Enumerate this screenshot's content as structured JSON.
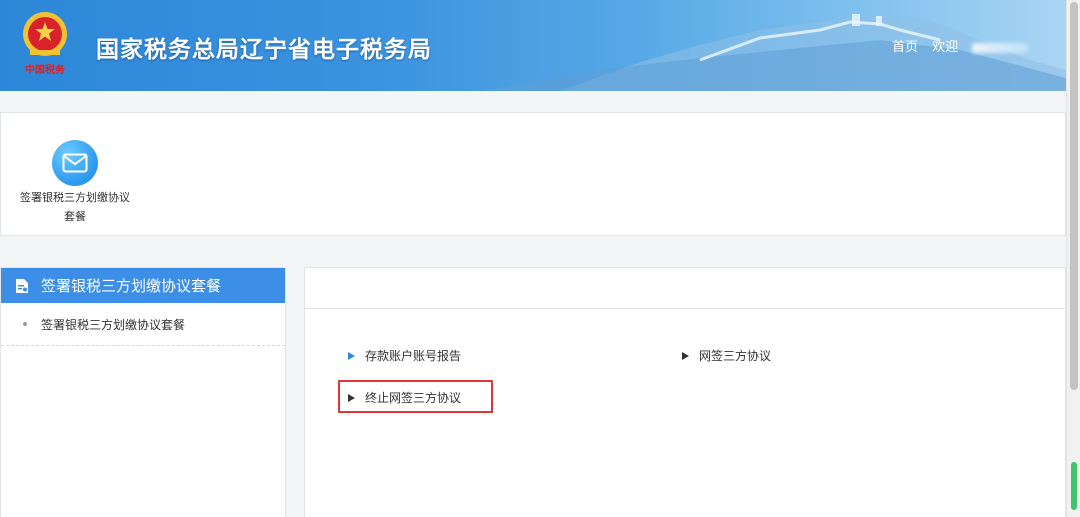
{
  "header": {
    "site_title": "国家税务总局辽宁省电子税务局",
    "emblem_text": "中国税务",
    "nav": {
      "home": "首页",
      "welcome": "欢迎"
    }
  },
  "shortcut_panel": {
    "items": [
      {
        "label_line1": "签署银税三方划缴协议",
        "label_line2": "套餐",
        "icon": "envelope-icon"
      }
    ]
  },
  "sidebar": {
    "header_label": "签署银税三方划缴协议套餐",
    "items": [
      {
        "label": "签署银税三方划缴协议套餐"
      }
    ]
  },
  "main": {
    "links": [
      {
        "label": "存款账户账号报告"
      },
      {
        "label": "网签三方协议"
      },
      {
        "label": "终止网签三方协议"
      }
    ]
  },
  "colors": {
    "header_blue": "#2d87d8",
    "sidebar_header": "#3c8ee6",
    "highlight_red": "#e0353a",
    "scroll_green": "#3ec66a"
  }
}
